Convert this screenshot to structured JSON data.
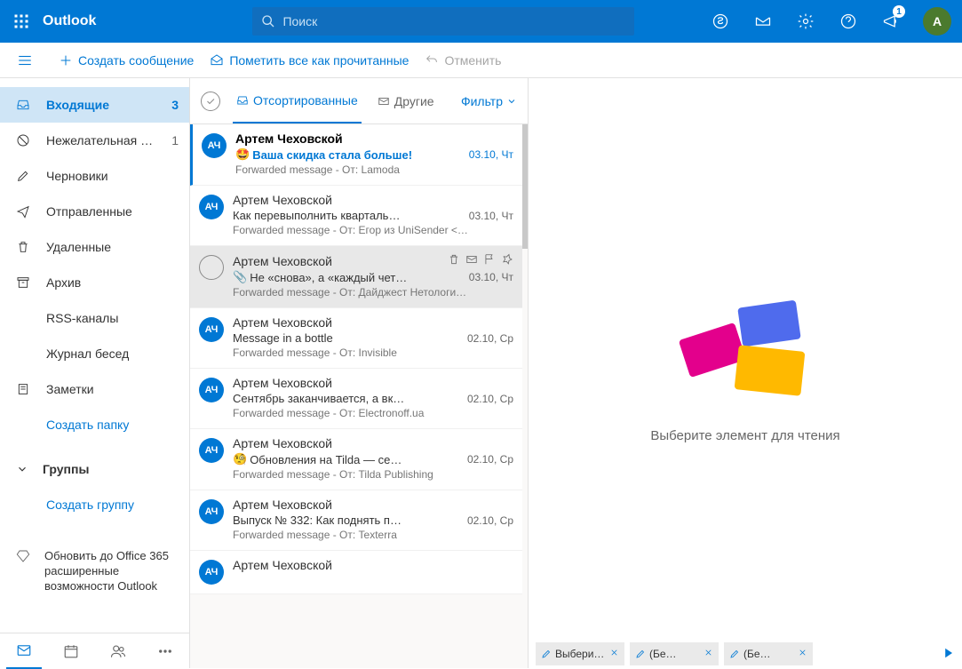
{
  "app": {
    "title": "Outlook"
  },
  "search": {
    "placeholder": "Поиск"
  },
  "notifications": {
    "count": 1
  },
  "user": {
    "initial": "A"
  },
  "commands": {
    "compose": "Создать сообщение",
    "mark_read": "Пометить все как прочитанные",
    "undo": "Отменить"
  },
  "folders": [
    {
      "icon": "inbox",
      "name": "Входящие",
      "count": "3",
      "selected": true
    },
    {
      "icon": "junk",
      "name": "Нежелательная …",
      "count": "1",
      "dim": true
    },
    {
      "icon": "draft",
      "name": "Черновики",
      "count": ""
    },
    {
      "icon": "sent",
      "name": "Отправленные",
      "count": ""
    },
    {
      "icon": "trash",
      "name": "Удаленные",
      "count": ""
    },
    {
      "icon": "archive",
      "name": "Архив",
      "count": ""
    },
    {
      "icon": "",
      "name": "RSS-каналы",
      "count": ""
    },
    {
      "icon": "",
      "name": "Журнал бесед",
      "count": ""
    },
    {
      "icon": "notes",
      "name": "Заметки",
      "count": ""
    },
    {
      "icon": "",
      "name": "Создать папку",
      "count": "",
      "link": true
    }
  ],
  "groups": {
    "label": "Группы",
    "create": "Создать группу"
  },
  "upgrade": "Обновить до Office 365 расширенные возможности Outlook",
  "list_header": {
    "focused": "Отсортированные",
    "other": "Другие",
    "filter": "Фильтр"
  },
  "messages": [
    {
      "from": "Артем Чеховской",
      "subject": "Ваша скидка стала больше!",
      "emoji": "🤩",
      "date": "03.10, Чт",
      "preview": "Forwarded message - От: Lamoda <newsletter…",
      "unread": true,
      "initials": "АЧ"
    },
    {
      "from": "Артем Чеховской",
      "subject": "Как перевыполнить кварталь…",
      "date": "03.10, Чт",
      "preview": "Forwarded message - От: Егор из UniSender <…",
      "initials": "АЧ"
    },
    {
      "from": "Артем Чеховской",
      "subject": "Не «снова», а «каждый чет…",
      "attach": true,
      "date": "03.10, Чт",
      "preview": "Forwarded message - От: Дайджест Нетологи…",
      "initials": "АЧ",
      "hover": true
    },
    {
      "from": "Артем Чеховской",
      "subject": "Message in a bottle",
      "date": "02.10, Ср",
      "preview": "Forwarded message - От: Invisible <info@invis…",
      "initials": "АЧ"
    },
    {
      "from": "Артем Чеховской",
      "subject": "Сентябрь заканчивается, а вк…",
      "date": "02.10, Ср",
      "preview": "Forwarded message - От: Electronoff.ua <sales…",
      "initials": "АЧ"
    },
    {
      "from": "Артем Чеховской",
      "subject": "Обновления на Tilda — се…",
      "emoji": "🧐",
      "date": "02.10, Ср",
      "preview": "Forwarded message - От: Tilda Publishing <hel…",
      "initials": "АЧ"
    },
    {
      "from": "Артем Чеховской",
      "subject": "Выпуск № 332: Как поднять п…",
      "date": "02.10, Ср",
      "preview": "Forwarded message - От: Texterra <partizan@…",
      "initials": "АЧ"
    },
    {
      "from": "Артем Чеховской",
      "subject": "",
      "date": "",
      "preview": "",
      "initials": "АЧ"
    }
  ],
  "reading": {
    "empty": "Выберите элемент для чтения"
  },
  "drafts": [
    {
      "label": "Выберит…"
    },
    {
      "label": "(Бе…"
    },
    {
      "label": "(Бе…"
    }
  ]
}
